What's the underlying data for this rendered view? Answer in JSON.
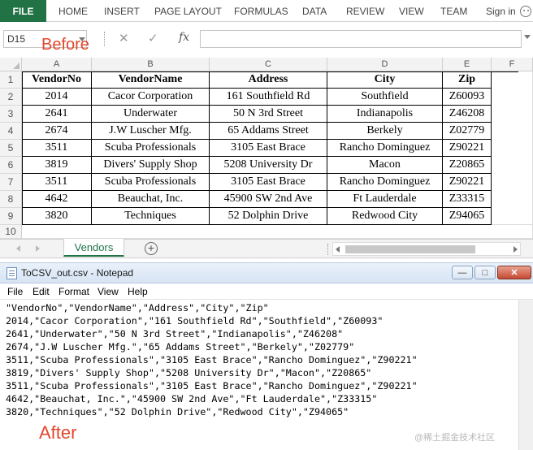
{
  "ribbon": {
    "file_tab": "FILE",
    "tabs": [
      "HOME",
      "INSERT",
      "PAGE LAYOUT",
      "FORMULAS",
      "DATA",
      "REVIEW",
      "VIEW",
      "TEAM"
    ],
    "sign_in": "Sign in"
  },
  "formula_bar": {
    "name_box": "D15",
    "annotation": "Before",
    "cancel_icon": "✕",
    "enter_icon": "✓",
    "fx_label": "fx",
    "formula_value": ""
  },
  "sheet": {
    "columns": [
      "A",
      "B",
      "C",
      "D",
      "E",
      "F"
    ],
    "rows": [
      "1",
      "2",
      "3",
      "4",
      "5",
      "6",
      "7",
      "8",
      "9",
      "10"
    ],
    "header": [
      "VendorNo",
      "VendorName",
      "Address",
      "City",
      "Zip"
    ],
    "data": [
      [
        "2014",
        "Cacor Corporation",
        "161 Southfield Rd",
        "Southfield",
        "Z60093"
      ],
      [
        "2641",
        "Underwater",
        "50 N 3rd Street",
        "Indianapolis",
        "Z46208"
      ],
      [
        "2674",
        "J.W Luscher Mfg.",
        "65 Addams Street",
        "Berkely",
        "Z02779"
      ],
      [
        "3511",
        "Scuba Professionals",
        "3105 East Brace",
        "Rancho Dominguez",
        "Z90221"
      ],
      [
        "3819",
        "Divers' Supply Shop",
        "5208 University Dr",
        "Macon",
        "Z20865"
      ],
      [
        "3511",
        "Scuba Professionals",
        "3105 East Brace",
        "Rancho Dominguez",
        "Z90221"
      ],
      [
        "4642",
        "Beauchat, Inc.",
        "45900 SW 2nd Ave",
        "Ft Lauderdale",
        "Z33315"
      ],
      [
        "3820",
        "Techniques",
        "52 Dolphin Drive",
        "Redwood City",
        "Z94065"
      ]
    ],
    "tab_name": "Vendors",
    "add_sheet": "+"
  },
  "notepad": {
    "title": "ToCSV_out.csv - Notepad",
    "menu": [
      "File",
      "Edit",
      "Format",
      "View",
      "Help"
    ],
    "lines": [
      "\"VendorNo\",\"VendorName\",\"Address\",\"City\",\"Zip\"",
      "2014,\"Cacor Corporation\",\"161 Southfield Rd\",\"Southfield\",\"Z60093\"",
      "2641,\"Underwater\",\"50 N 3rd Street\",\"Indianapolis\",\"Z46208\"",
      "2674,\"J.W Luscher Mfg.\",\"65 Addams Street\",\"Berkely\",\"Z02779\"",
      "3511,\"Scuba Professionals\",\"3105 East Brace\",\"Rancho Dominguez\",\"Z90221\"",
      "3819,\"Divers' Supply Shop\",\"5208 University Dr\",\"Macon\",\"Z20865\"",
      "3511,\"Scuba Professionals\",\"3105 East Brace\",\"Rancho Dominguez\",\"Z90221\"",
      "4642,\"Beauchat, Inc.\",\"45900 SW 2nd Ave\",\"Ft Lauderdale\",\"Z33315\"",
      "3820,\"Techniques\",\"52 Dolphin Drive\",\"Redwood City\",\"Z94065\""
    ],
    "annotation": "After"
  },
  "watermark": "@稀土掘金技术社区",
  "colors": {
    "excel_green": "#217346",
    "annotation_red": "#e2462c"
  }
}
